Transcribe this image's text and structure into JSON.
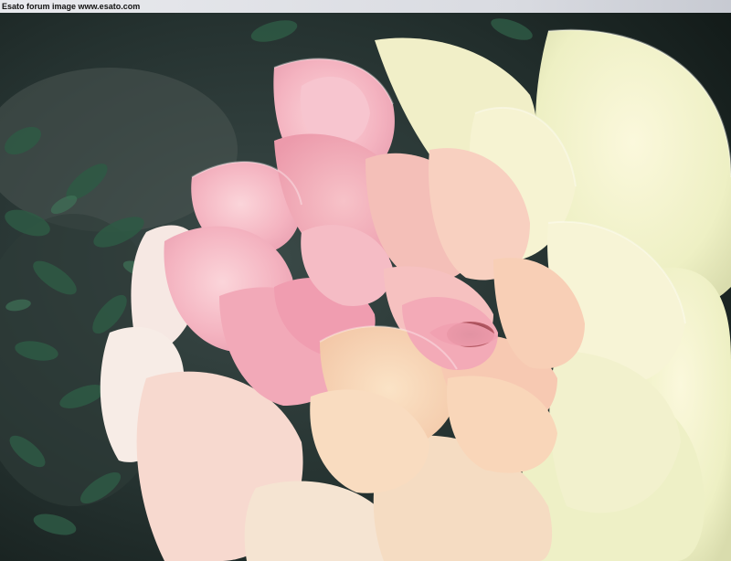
{
  "banner": {
    "text": "Esato forum image www.esato.com"
  },
  "photo": {
    "subject": "rose-flower",
    "colors": {
      "petal_pink": "#f2a9b8",
      "petal_peach": "#f7d2b4",
      "petal_cream": "#f3f1c9",
      "foliage": "#2d4a3c",
      "background_dark": "#1b2422"
    }
  }
}
